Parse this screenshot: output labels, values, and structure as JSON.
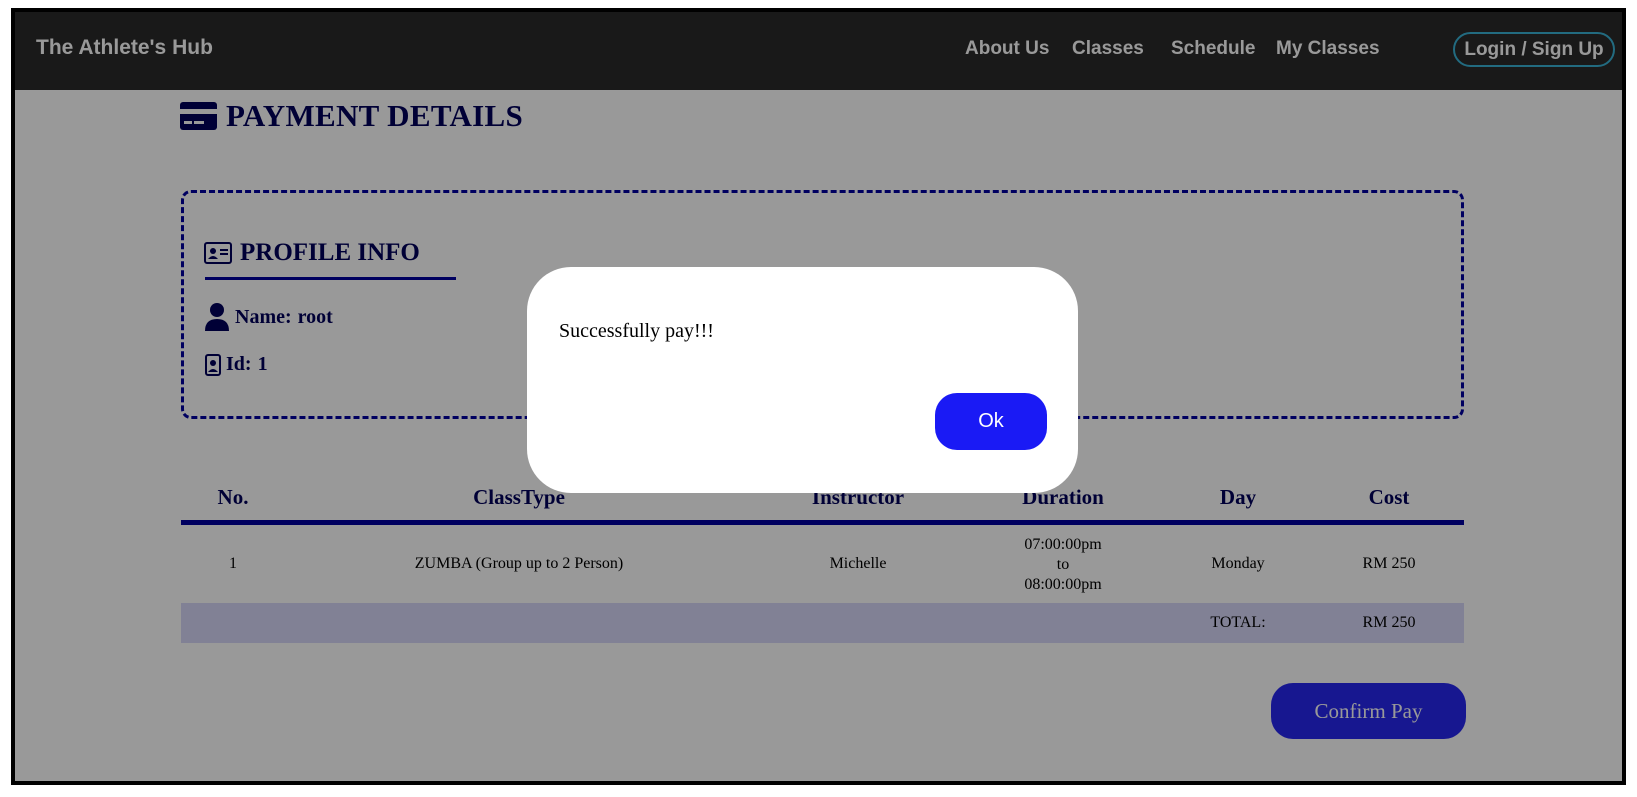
{
  "navbar": {
    "brand": "The Athlete's Hub",
    "links": [
      "About Us",
      "Classes",
      "Schedule",
      "My Classes"
    ],
    "login_label": "Login / Sign Up"
  },
  "page": {
    "title": "PAYMENT DETAILS",
    "title_icon": "credit-card-icon"
  },
  "profile": {
    "heading": "PROFILE INFO",
    "heading_icon": "id-card-icon",
    "name_label": "Name:",
    "name_value": "root",
    "name_icon": "user-icon",
    "id_label": "Id:",
    "id_value": "1",
    "id_icon": "id-badge-icon"
  },
  "table": {
    "headers": [
      "No.",
      "ClassType",
      "Instructor",
      "Duration",
      "Day",
      "Cost"
    ],
    "rows": [
      {
        "no": "1",
        "class_type": "ZUMBA (Group up to 2 Person)",
        "instructor": "Michelle",
        "duration_start": "07:00:00pm",
        "duration_sep": "to",
        "duration_end": "08:00:00pm",
        "day": "Monday",
        "cost": "RM 250"
      }
    ],
    "total_label": "TOTAL:",
    "total_value": "RM 250"
  },
  "confirm_label": "Confirm Pay",
  "dialog": {
    "message": "Successfully pay!!!",
    "ok_label": "Ok"
  },
  "colors": {
    "navbar": "#2a2a2a",
    "heading": "#00005a",
    "accent": "#0000a0",
    "button": "#2727f0",
    "login_border": "#3ab3d6"
  }
}
